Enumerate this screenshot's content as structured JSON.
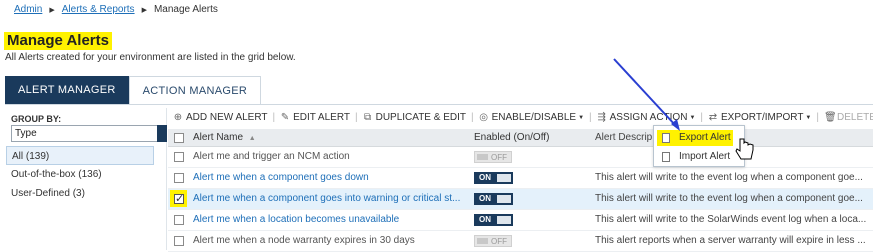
{
  "breadcrumb": {
    "items": [
      "Admin",
      "Alerts & Reports"
    ],
    "current": "Manage Alerts"
  },
  "page": {
    "title": "Manage Alerts",
    "subtitle": "All Alerts created for your environment are listed in the grid below."
  },
  "tabs": [
    {
      "label": "ALERT MANAGER",
      "active": true
    },
    {
      "label": "ACTION MANAGER",
      "active": false
    }
  ],
  "group_panel": {
    "label": "GROUP BY:",
    "select_value": "Type",
    "items": [
      "All (139)",
      "Out-of-the-box (136)",
      "User-Defined (3)"
    ]
  },
  "toolbar": {
    "add": "ADD NEW ALERT",
    "edit": "EDIT ALERT",
    "duplicate": "DUPLICATE & EDIT",
    "enable": "ENABLE/DISABLE",
    "assign": "ASSIGN ACTION",
    "export": "EXPORT/IMPORT",
    "delete": "DELETE"
  },
  "grid": {
    "headers": {
      "name": "Alert Name",
      "sort_glyph": "▲",
      "enabled": "Enabled (On/Off)",
      "desc": "Alert Descrip"
    },
    "rows": [
      {
        "name": "Alert me and trigger an NCM action",
        "state": "OFF",
        "desc": ""
      },
      {
        "name": "Alert me when a component goes down",
        "state": "ON",
        "desc": "This alert will write to the event log when a component goe..."
      },
      {
        "name": "Alert me when a component goes into warning or critical st...",
        "state": "ON",
        "desc": "This alert will write to the event log when a component goe..."
      },
      {
        "name": "Alert me when a location becomes unavailable",
        "state": "ON",
        "desc": "This alert will write to the SolarWinds event log when a loca..."
      },
      {
        "name": "Alert me when a node warranty expires in 30 days",
        "state": "OFF",
        "desc": "This alert reports when a server warranty will expire in less ..."
      }
    ]
  },
  "dropdown": {
    "items": [
      "Export Alert",
      "Import Alert"
    ]
  },
  "colors": {
    "highlight": "#fff200",
    "navy": "#1a3a5c",
    "link": "#1e6fb8",
    "arrow": "#2a3fd1"
  }
}
